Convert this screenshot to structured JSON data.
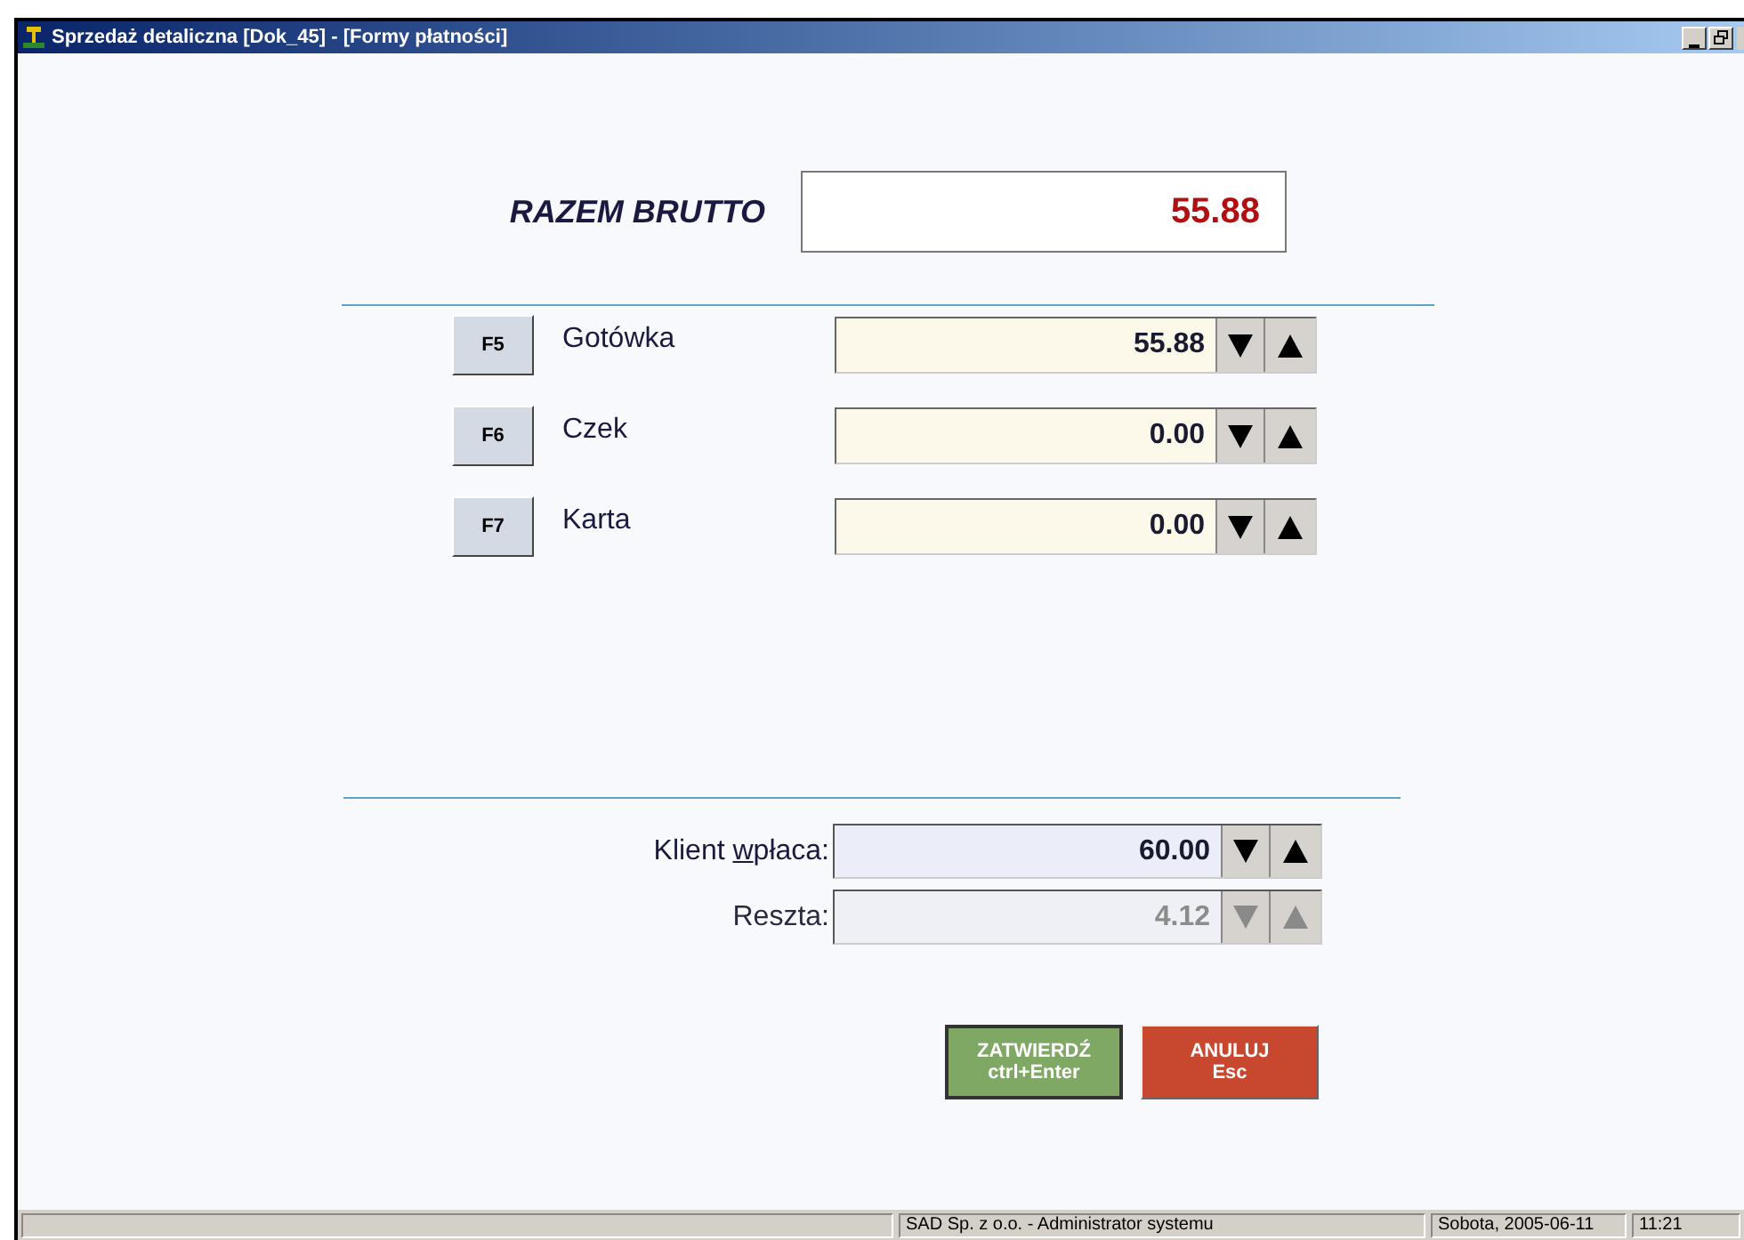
{
  "window": {
    "title": "Sprzedaż detaliczna [Dok_45] - [Formy płatności]"
  },
  "total": {
    "label": "RAZEM BRUTTO",
    "value": "55.88"
  },
  "payments": [
    {
      "key": "F5",
      "label": "Gotówka",
      "value": "55.88"
    },
    {
      "key": "F6",
      "label": "Czek",
      "value": "0.00"
    },
    {
      "key": "F7",
      "label": "Karta",
      "value": "0.00"
    }
  ],
  "summary": [
    {
      "label_before": "Klient ",
      "accelerator": "w",
      "label_after": "płaca:",
      "value": "60.00",
      "disabled": false
    },
    {
      "label_before": "Reszta:",
      "value": "4.12",
      "disabled": true
    }
  ],
  "buttons": [
    {
      "kind": "confirm",
      "label": "ZATWIERDŹ",
      "shortcut": "ctrl+Enter"
    },
    {
      "kind": "cancel",
      "label": "ANULUJ",
      "shortcut": "Esc"
    }
  ],
  "status_bar": [
    "SAD Sp. z o.o. - Administrator systemu",
    "Sobota, 2005-06-11",
    "11:21"
  ]
}
